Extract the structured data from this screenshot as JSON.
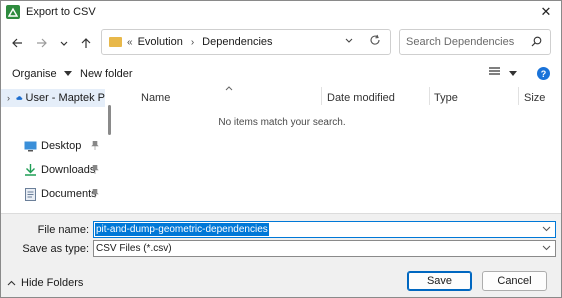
{
  "window": {
    "title": "Export to CSV"
  },
  "nav": {
    "breadcrumb": [
      "Evolution",
      "Dependencies"
    ],
    "breadcrumb_overflow": "«",
    "search_placeholder": "Search Dependencies"
  },
  "commands": {
    "organise": "Organise",
    "new_folder": "New folder"
  },
  "sidebar": {
    "items": [
      {
        "label": "User - Maptek P",
        "icon": "cloud-icon"
      },
      {
        "label": "Desktop",
        "icon": "desktop-icon"
      },
      {
        "label": "Downloads",
        "icon": "downloads-icon"
      },
      {
        "label": "Documents",
        "icon": "documents-icon"
      }
    ]
  },
  "file_list": {
    "columns": [
      "Name",
      "Date modified",
      "Type",
      "Size"
    ],
    "empty_message": "No items match your search."
  },
  "form": {
    "file_name_label": "File name:",
    "file_name_value": "pit-and-dump-geometric-dependencies",
    "save_type_label": "Save as type:",
    "save_type_value": "CSV Files (*.csv)"
  },
  "buttons": {
    "save": "Save",
    "cancel": "Cancel",
    "hide_folders": "Hide Folders"
  },
  "colors": {
    "accent": "#0078d7",
    "folder": "#e8b84a",
    "app_icon": "#2e8b3e"
  }
}
